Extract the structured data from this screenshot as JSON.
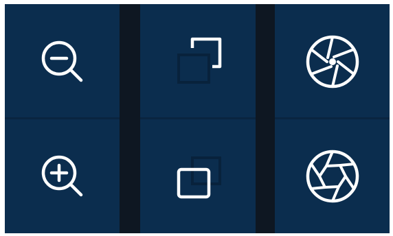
{
  "panel": {
    "columns": [
      {
        "top": {
          "action": "zoom-out",
          "icon": "zoom-out-icon"
        },
        "bottom": {
          "action": "zoom-in",
          "icon": "zoom-in-icon"
        }
      },
      {
        "top": {
          "action": "focus-far",
          "icon": "focus-far-icon"
        },
        "bottom": {
          "action": "focus-near",
          "icon": "focus-near-icon"
        }
      },
      {
        "top": {
          "action": "iris-close",
          "icon": "iris-close-icon"
        },
        "bottom": {
          "action": "iris-open",
          "icon": "iris-open-icon"
        }
      }
    ],
    "colors": {
      "background": "#0b2d4e",
      "separator": "#0e1722",
      "icon": "#ffffff",
      "icon_shadow": "#08223c"
    }
  }
}
